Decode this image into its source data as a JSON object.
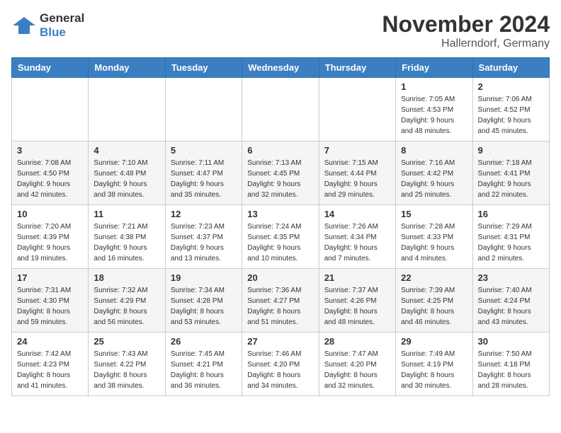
{
  "logo": {
    "general": "General",
    "blue": "Blue"
  },
  "header": {
    "month": "November 2024",
    "location": "Hallerndorf, Germany"
  },
  "weekdays": [
    "Sunday",
    "Monday",
    "Tuesday",
    "Wednesday",
    "Thursday",
    "Friday",
    "Saturday"
  ],
  "weeks": [
    [
      {
        "day": "",
        "info": ""
      },
      {
        "day": "",
        "info": ""
      },
      {
        "day": "",
        "info": ""
      },
      {
        "day": "",
        "info": ""
      },
      {
        "day": "",
        "info": ""
      },
      {
        "day": "1",
        "info": "Sunrise: 7:05 AM\nSunset: 4:53 PM\nDaylight: 9 hours\nand 48 minutes."
      },
      {
        "day": "2",
        "info": "Sunrise: 7:06 AM\nSunset: 4:52 PM\nDaylight: 9 hours\nand 45 minutes."
      }
    ],
    [
      {
        "day": "3",
        "info": "Sunrise: 7:08 AM\nSunset: 4:50 PM\nDaylight: 9 hours\nand 42 minutes."
      },
      {
        "day": "4",
        "info": "Sunrise: 7:10 AM\nSunset: 4:48 PM\nDaylight: 9 hours\nand 38 minutes."
      },
      {
        "day": "5",
        "info": "Sunrise: 7:11 AM\nSunset: 4:47 PM\nDaylight: 9 hours\nand 35 minutes."
      },
      {
        "day": "6",
        "info": "Sunrise: 7:13 AM\nSunset: 4:45 PM\nDaylight: 9 hours\nand 32 minutes."
      },
      {
        "day": "7",
        "info": "Sunrise: 7:15 AM\nSunset: 4:44 PM\nDaylight: 9 hours\nand 29 minutes."
      },
      {
        "day": "8",
        "info": "Sunrise: 7:16 AM\nSunset: 4:42 PM\nDaylight: 9 hours\nand 25 minutes."
      },
      {
        "day": "9",
        "info": "Sunrise: 7:18 AM\nSunset: 4:41 PM\nDaylight: 9 hours\nand 22 minutes."
      }
    ],
    [
      {
        "day": "10",
        "info": "Sunrise: 7:20 AM\nSunset: 4:39 PM\nDaylight: 9 hours\nand 19 minutes."
      },
      {
        "day": "11",
        "info": "Sunrise: 7:21 AM\nSunset: 4:38 PM\nDaylight: 9 hours\nand 16 minutes."
      },
      {
        "day": "12",
        "info": "Sunrise: 7:23 AM\nSunset: 4:37 PM\nDaylight: 9 hours\nand 13 minutes."
      },
      {
        "day": "13",
        "info": "Sunrise: 7:24 AM\nSunset: 4:35 PM\nDaylight: 9 hours\nand 10 minutes."
      },
      {
        "day": "14",
        "info": "Sunrise: 7:26 AM\nSunset: 4:34 PM\nDaylight: 9 hours\nand 7 minutes."
      },
      {
        "day": "15",
        "info": "Sunrise: 7:28 AM\nSunset: 4:33 PM\nDaylight: 9 hours\nand 4 minutes."
      },
      {
        "day": "16",
        "info": "Sunrise: 7:29 AM\nSunset: 4:31 PM\nDaylight: 9 hours\nand 2 minutes."
      }
    ],
    [
      {
        "day": "17",
        "info": "Sunrise: 7:31 AM\nSunset: 4:30 PM\nDaylight: 8 hours\nand 59 minutes."
      },
      {
        "day": "18",
        "info": "Sunrise: 7:32 AM\nSunset: 4:29 PM\nDaylight: 8 hours\nand 56 minutes."
      },
      {
        "day": "19",
        "info": "Sunrise: 7:34 AM\nSunset: 4:28 PM\nDaylight: 8 hours\nand 53 minutes."
      },
      {
        "day": "20",
        "info": "Sunrise: 7:36 AM\nSunset: 4:27 PM\nDaylight: 8 hours\nand 51 minutes."
      },
      {
        "day": "21",
        "info": "Sunrise: 7:37 AM\nSunset: 4:26 PM\nDaylight: 8 hours\nand 48 minutes."
      },
      {
        "day": "22",
        "info": "Sunrise: 7:39 AM\nSunset: 4:25 PM\nDaylight: 8 hours\nand 46 minutes."
      },
      {
        "day": "23",
        "info": "Sunrise: 7:40 AM\nSunset: 4:24 PM\nDaylight: 8 hours\nand 43 minutes."
      }
    ],
    [
      {
        "day": "24",
        "info": "Sunrise: 7:42 AM\nSunset: 4:23 PM\nDaylight: 8 hours\nand 41 minutes."
      },
      {
        "day": "25",
        "info": "Sunrise: 7:43 AM\nSunset: 4:22 PM\nDaylight: 8 hours\nand 38 minutes."
      },
      {
        "day": "26",
        "info": "Sunrise: 7:45 AM\nSunset: 4:21 PM\nDaylight: 8 hours\nand 36 minutes."
      },
      {
        "day": "27",
        "info": "Sunrise: 7:46 AM\nSunset: 4:20 PM\nDaylight: 8 hours\nand 34 minutes."
      },
      {
        "day": "28",
        "info": "Sunrise: 7:47 AM\nSunset: 4:20 PM\nDaylight: 8 hours\nand 32 minutes."
      },
      {
        "day": "29",
        "info": "Sunrise: 7:49 AM\nSunset: 4:19 PM\nDaylight: 8 hours\nand 30 minutes."
      },
      {
        "day": "30",
        "info": "Sunrise: 7:50 AM\nSunset: 4:18 PM\nDaylight: 8 hours\nand 28 minutes."
      }
    ]
  ]
}
